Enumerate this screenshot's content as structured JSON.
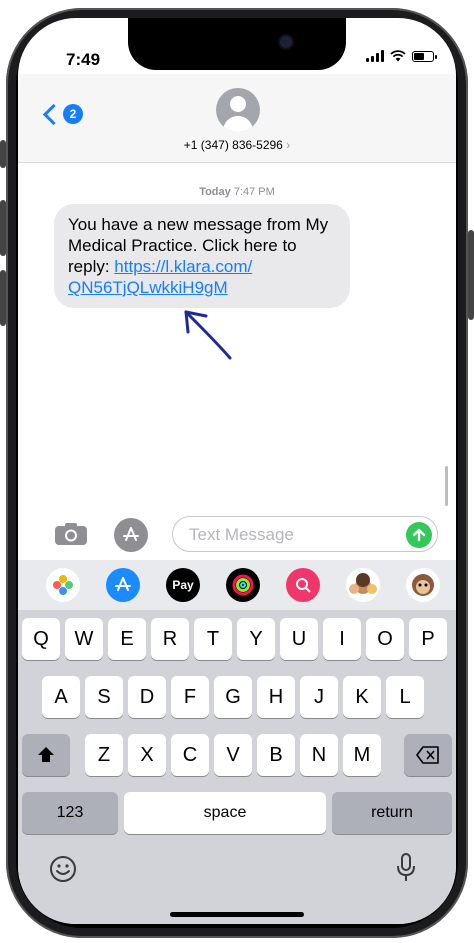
{
  "status_bar": {
    "time": "7:49"
  },
  "header": {
    "back_badge": "2",
    "contact": "+1 (347) 836-5296",
    "contact_chevron": "›"
  },
  "conversation": {
    "timestamp_day": "Today",
    "timestamp_time": "7:47 PM",
    "message_text": "You have a new message from My Medical Practice. Click here to reply: ",
    "message_link": "https://l.klara.com/ QN56TjQLwkkiH9gM"
  },
  "composer": {
    "placeholder": "Text Message"
  },
  "app_drawer": {
    "items": [
      "photos-app-icon",
      "app-store-app-icon",
      "apple-pay-app-icon",
      "activity-app-icon",
      "images-search-app-icon",
      "memoji-app-icon",
      "animoji-app-icon"
    ],
    "apple_pay_label": "Pay"
  },
  "keyboard": {
    "row1": [
      "Q",
      "W",
      "E",
      "R",
      "T",
      "Y",
      "U",
      "I",
      "O",
      "P"
    ],
    "row2": [
      "A",
      "S",
      "D",
      "F",
      "G",
      "H",
      "J",
      "K",
      "L"
    ],
    "row3": [
      "Z",
      "X",
      "C",
      "V",
      "B",
      "N",
      "M"
    ],
    "numbers_label": "123",
    "space_label": "space",
    "return_label": "return"
  },
  "colors": {
    "accent": "#147efb",
    "send": "#34c759",
    "bubble": "#e9e9eb"
  }
}
